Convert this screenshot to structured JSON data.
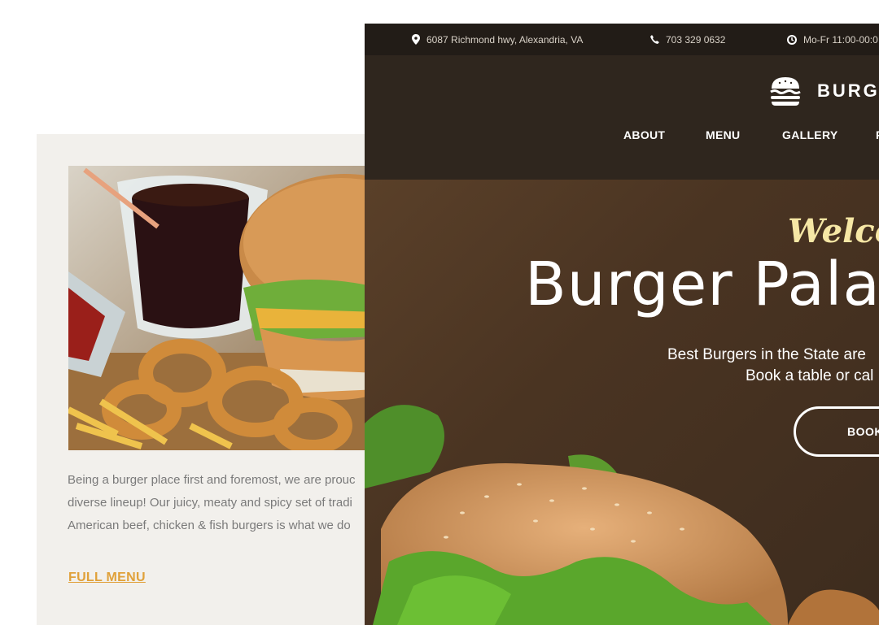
{
  "card": {
    "description_lines": [
      "Being a burger place first and foremost, we are prouc",
      "diverse lineup! Our juicy, meaty and spicy set of tradi",
      "American beef, chicken & fish burgers is what we do"
    ],
    "full_menu_label": "FULL MENU"
  },
  "topbar": {
    "address": "6087 Richmond hwy, Alexandria, VA",
    "phone": "703 329 0632",
    "hours": "Mo-Fr 11:00-00:0"
  },
  "header": {
    "brand": "BURG",
    "nav": [
      "ABOUT",
      "MENU",
      "GALLERY",
      "R"
    ]
  },
  "hero": {
    "welcome": "Welcon",
    "title": "Burger Palac",
    "subtitle_line1": "Best Burgers in the State are",
    "subtitle_line2": "Book a table or cal",
    "button_label": "BOOK"
  },
  "colors": {
    "accent": "#e0a13a",
    "welcome": "#f6e7a5",
    "topbar_bg": "#221c17",
    "header_bg": "#2f261e",
    "card_bg": "#f2f0ec"
  }
}
